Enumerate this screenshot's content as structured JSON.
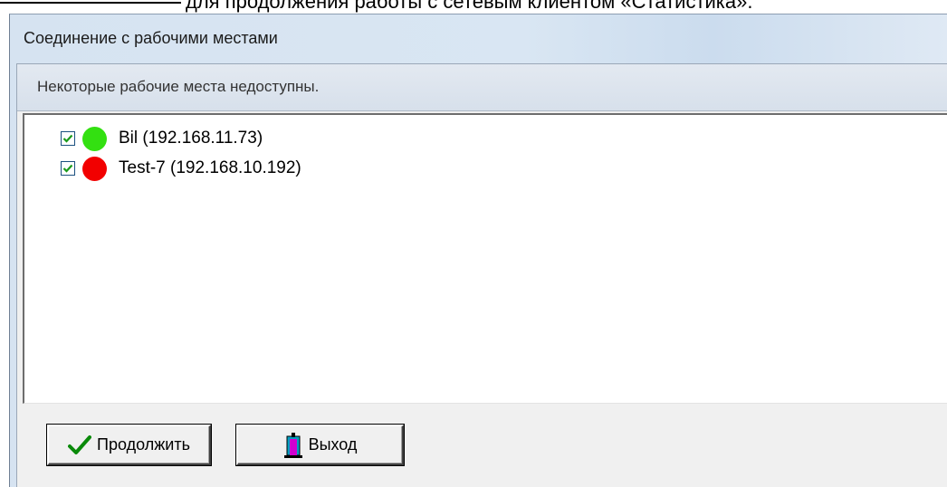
{
  "document": {
    "cut_line": "для продолжения работы с сетевым клиентом «Статистика»."
  },
  "window": {
    "title": "Соединение с рабочими местами"
  },
  "info": {
    "message": "Некоторые рабочие места недоступны."
  },
  "workstations": [
    {
      "label": "Bil (192.168.11.73)",
      "checked": true,
      "status": "online",
      "status_color": "#33e011"
    },
    {
      "label": "Test-7 (192.168.10.192)",
      "checked": true,
      "status": "offline",
      "status_color": "#f20000"
    }
  ],
  "buttons": {
    "continue_label": "Продолжить",
    "continue_icon": "checkmark-icon",
    "exit_label": "Выход",
    "exit_icon": "exit-door-icon"
  },
  "colors": {
    "checkmark": "#1a9a1a",
    "online": "#33e011",
    "offline": "#f20000"
  }
}
